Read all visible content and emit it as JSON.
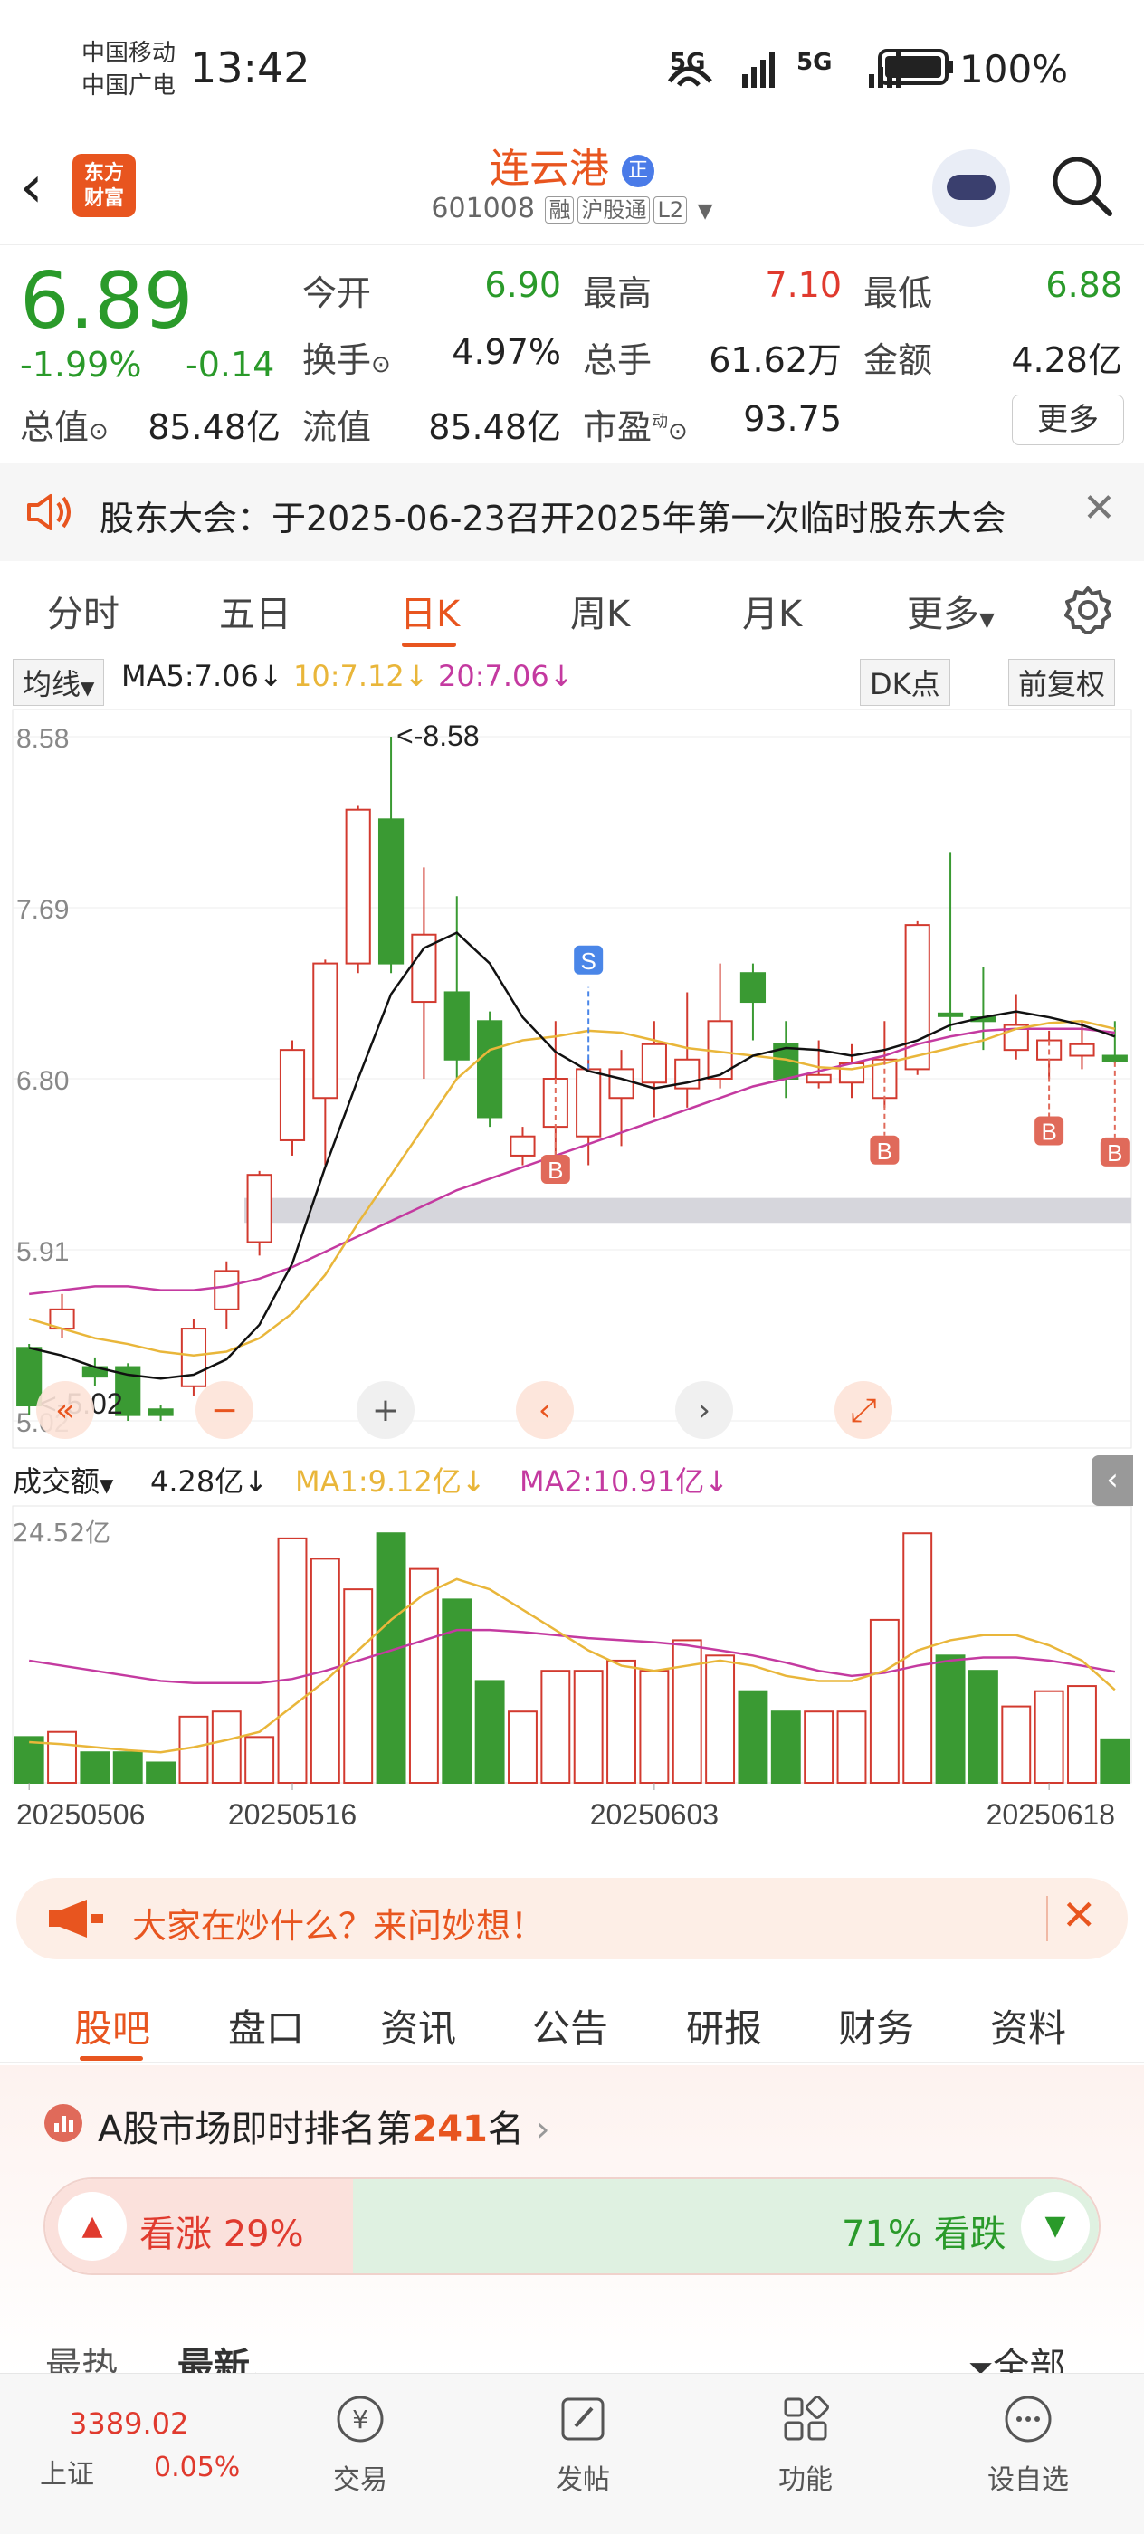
{
  "status_bar": {
    "carrier1": "中国移动",
    "carrier2": "中国广电",
    "time": "13:42",
    "network1": "5G",
    "network2": "5G",
    "battery": "100%"
  },
  "header": {
    "logo_line1": "东方",
    "logo_line2": "财富",
    "stock_name": "连云港",
    "badge": "正",
    "stock_code": "601008",
    "tag1": "融",
    "tag2": "沪股通",
    "tag3": "L2"
  },
  "quote": {
    "price": "6.89",
    "change_pct": "-1.99%",
    "change": "-0.14",
    "open_label": "今开",
    "open": "6.90",
    "high_label": "最高",
    "high": "7.10",
    "low_label": "最低",
    "low": "6.88",
    "turnover_label": "换手",
    "turnover": "4.97%",
    "volume_label": "总手",
    "volume": "61.62万",
    "amount_label": "金额",
    "amount": "4.28亿",
    "mktcap_label": "总值",
    "mktcap": "85.48亿",
    "float_label": "流值",
    "float": "85.48亿",
    "pe_label": "市盈",
    "pe_sup": "动",
    "pe": "93.75",
    "more": "更多"
  },
  "notice": {
    "text": "股东大会：于2025-06-23召开2025年第一次临时股东大会"
  },
  "chart_tabs": [
    "分时",
    "五日",
    "日K",
    "周K",
    "月K",
    "更多"
  ],
  "chart_header": {
    "ma_select": "均线",
    "ma5": "MA5:7.06↓",
    "ma10": "10:7.12↓",
    "ma20": "20:7.06↓",
    "dk": "DK点",
    "adjust": "前复权"
  },
  "volume_header": {
    "label": "成交额",
    "value": "4.28亿↓",
    "ma1": "MA1:9.12亿↓",
    "ma2": "MA2:10.91亿↓",
    "max": "24.52亿"
  },
  "chart_data": {
    "type": "candlestick",
    "y_ticks": [
      "8.58",
      "7.69",
      "6.80",
      "5.91",
      "5.02"
    ],
    "ylim": [
      5.02,
      8.58
    ],
    "high_annotation": "<-8.58",
    "low_annotation": "<-5.02",
    "x_labels": [
      "20250506",
      "20250516",
      "20250603",
      "20250618"
    ],
    "signals": [
      "S",
      "B",
      "B",
      "B",
      "B"
    ],
    "candles": [
      {
        "o": 5.4,
        "c": 5.1,
        "h": 5.42,
        "l": 5.05,
        "up": false
      },
      {
        "o": 5.5,
        "c": 5.6,
        "h": 5.68,
        "l": 5.45,
        "up": true
      },
      {
        "o": 5.3,
        "c": 5.25,
        "h": 5.35,
        "l": 5.2,
        "up": false
      },
      {
        "o": 5.3,
        "c": 5.05,
        "h": 5.32,
        "l": 5.02,
        "up": false
      },
      {
        "o": 5.08,
        "c": 5.05,
        "h": 5.1,
        "l": 5.02,
        "up": false
      },
      {
        "o": 5.2,
        "c": 5.5,
        "h": 5.55,
        "l": 5.15,
        "up": true
      },
      {
        "o": 5.6,
        "c": 5.8,
        "h": 5.85,
        "l": 5.5,
        "up": true
      },
      {
        "o": 5.95,
        "c": 6.3,
        "h": 6.32,
        "l": 5.88,
        "up": true
      },
      {
        "o": 6.48,
        "c": 6.95,
        "h": 7.0,
        "l": 6.4,
        "up": true
      },
      {
        "o": 6.7,
        "c": 7.4,
        "h": 7.42,
        "l": 6.35,
        "up": true
      },
      {
        "o": 7.4,
        "c": 8.2,
        "h": 8.22,
        "l": 7.35,
        "up": true
      },
      {
        "o": 8.15,
        "c": 7.4,
        "h": 8.58,
        "l": 7.35,
        "up": false
      },
      {
        "o": 7.2,
        "c": 7.55,
        "h": 7.9,
        "l": 6.8,
        "up": true
      },
      {
        "o": 7.25,
        "c": 6.9,
        "h": 7.75,
        "l": 6.8,
        "up": false
      },
      {
        "o": 7.1,
        "c": 6.6,
        "h": 7.15,
        "l": 6.55,
        "up": false
      },
      {
        "o": 6.4,
        "c": 6.5,
        "h": 6.55,
        "l": 6.35,
        "up": true
      },
      {
        "o": 6.55,
        "c": 6.8,
        "h": 7.1,
        "l": 6.4,
        "up": true
      },
      {
        "o": 6.5,
        "c": 6.85,
        "h": 6.9,
        "l": 6.35,
        "up": true
      },
      {
        "o": 6.7,
        "c": 6.85,
        "h": 6.95,
        "l": 6.45,
        "up": true
      },
      {
        "o": 6.78,
        "c": 6.98,
        "h": 7.1,
        "l": 6.6,
        "up": true
      },
      {
        "o": 6.75,
        "c": 6.9,
        "h": 7.25,
        "l": 6.65,
        "up": true
      },
      {
        "o": 6.8,
        "c": 7.1,
        "h": 7.4,
        "l": 6.75,
        "up": true
      },
      {
        "o": 7.35,
        "c": 7.2,
        "h": 7.4,
        "l": 7.0,
        "up": false
      },
      {
        "o": 6.98,
        "c": 6.8,
        "h": 7.1,
        "l": 6.7,
        "up": false
      },
      {
        "o": 6.78,
        "c": 6.82,
        "h": 7.0,
        "l": 6.75,
        "up": true
      },
      {
        "o": 6.78,
        "c": 6.88,
        "h": 6.98,
        "l": 6.7,
        "up": true
      },
      {
        "o": 6.7,
        "c": 6.9,
        "h": 7.1,
        "l": 6.65,
        "up": true
      },
      {
        "o": 6.85,
        "c": 7.6,
        "h": 7.62,
        "l": 6.82,
        "up": true
      },
      {
        "o": 7.14,
        "c": 7.14,
        "h": 7.98,
        "l": 7.05,
        "up": false
      },
      {
        "o": 7.12,
        "c": 7.1,
        "h": 7.38,
        "l": 6.95,
        "up": false
      },
      {
        "o": 6.95,
        "c": 7.08,
        "h": 7.24,
        "l": 6.9,
        "up": true
      },
      {
        "o": 6.9,
        "c": 7.0,
        "h": 7.05,
        "l": 6.8,
        "up": true
      },
      {
        "o": 6.92,
        "c": 6.98,
        "h": 7.1,
        "l": 6.85,
        "up": true
      },
      {
        "o": 6.92,
        "c": 6.89,
        "h": 7.1,
        "l": 6.88,
        "up": false
      }
    ],
    "ma5": [
      5.4,
      5.36,
      5.3,
      5.26,
      5.24,
      5.26,
      5.34,
      5.52,
      5.84,
      6.34,
      6.8,
      7.24,
      7.48,
      7.56,
      7.4,
      7.12,
      6.94,
      6.84,
      6.8,
      6.75,
      6.78,
      6.82,
      6.92,
      6.96,
      6.95,
      6.92,
      6.95,
      7.0,
      7.08,
      7.12,
      7.15,
      7.12,
      7.08,
      7.02
    ],
    "ma10": [
      5.55,
      5.5,
      5.45,
      5.42,
      5.38,
      5.36,
      5.38,
      5.45,
      5.58,
      5.78,
      6.05,
      6.3,
      6.55,
      6.8,
      6.95,
      7.0,
      7.02,
      7.05,
      7.04,
      7.0,
      6.96,
      6.94,
      6.92,
      6.9,
      6.86,
      6.85,
      6.88,
      6.92,
      6.96,
      7.0,
      7.06,
      7.09,
      7.1,
      7.06
    ],
    "ma20": [
      5.68,
      5.7,
      5.72,
      5.72,
      5.7,
      5.7,
      5.72,
      5.76,
      5.82,
      5.9,
      5.98,
      6.06,
      6.14,
      6.22,
      6.28,
      6.34,
      6.4,
      6.46,
      6.52,
      6.58,
      6.64,
      6.7,
      6.76,
      6.8,
      6.84,
      6.88,
      6.92,
      6.98,
      7.02,
      7.05,
      7.06,
      7.06,
      7.06,
      7.04
    ],
    "volume": [
      4.5,
      5.0,
      3.0,
      3.0,
      2.0,
      6.5,
      7.0,
      4.5,
      24.0,
      22.0,
      19.0,
      24.5,
      21.0,
      18.0,
      10.0,
      7.0,
      11.0,
      11.0,
      12.0,
      11.0,
      14.0,
      12.5,
      9.0,
      7.0,
      7.0,
      7.0,
      16.0,
      24.5,
      12.5,
      11.0,
      7.5,
      9.0,
      9.5,
      4.28
    ],
    "volume_ylim": [
      0,
      24.52
    ]
  },
  "volume_ma1": [
    4.0,
    3.8,
    3.5,
    3.2,
    3.0,
    3.5,
    4.2,
    5.0,
    7.5,
    10.0,
    13.0,
    16.0,
    18.5,
    20.0,
    19.0,
    17.0,
    15.0,
    13.0,
    11.5,
    11.0,
    11.5,
    12.0,
    11.5,
    10.5,
    10.0,
    10.0,
    11.0,
    13.0,
    14.0,
    14.5,
    14.5,
    13.5,
    12.0,
    9.12
  ],
  "volume_ma2": [
    12.0,
    11.5,
    11.0,
    10.5,
    10.0,
    9.8,
    9.8,
    9.8,
    10.2,
    11.0,
    12.0,
    13.0,
    14.0,
    15.0,
    15.0,
    14.8,
    14.5,
    14.2,
    14.0,
    13.8,
    13.5,
    13.0,
    12.5,
    11.8,
    11.0,
    10.5,
    10.8,
    11.5,
    12.0,
    12.3,
    12.3,
    12.0,
    11.5,
    10.91
  ],
  "banner": {
    "text": "大家在炒什么？来问妙想！"
  },
  "sub_tabs": [
    "股吧",
    "盘口",
    "资讯",
    "公告",
    "研报",
    "财务",
    "资料"
  ],
  "ranking": {
    "prefix": "A股市场即时排名第",
    "rank": "241",
    "suffix": "名",
    "up_label": "看涨 29%",
    "down_label": "71% 看跌",
    "up_fraction": 0.29
  },
  "feed_tabs": {
    "hot": "最热",
    "new": "最新",
    "all": "全部"
  },
  "bottom_nav": {
    "index_value": "3389.02",
    "index_name": "上证",
    "index_change": "0.05%",
    "items": [
      "交易",
      "发帖",
      "功能",
      "设自选"
    ]
  },
  "colors": {
    "up": "#d23a2f",
    "down": "#3a9a33",
    "accent": "#e8551f",
    "ma5": "#111111",
    "ma10": "#e9b63a",
    "ma20": "#c43aa0"
  }
}
